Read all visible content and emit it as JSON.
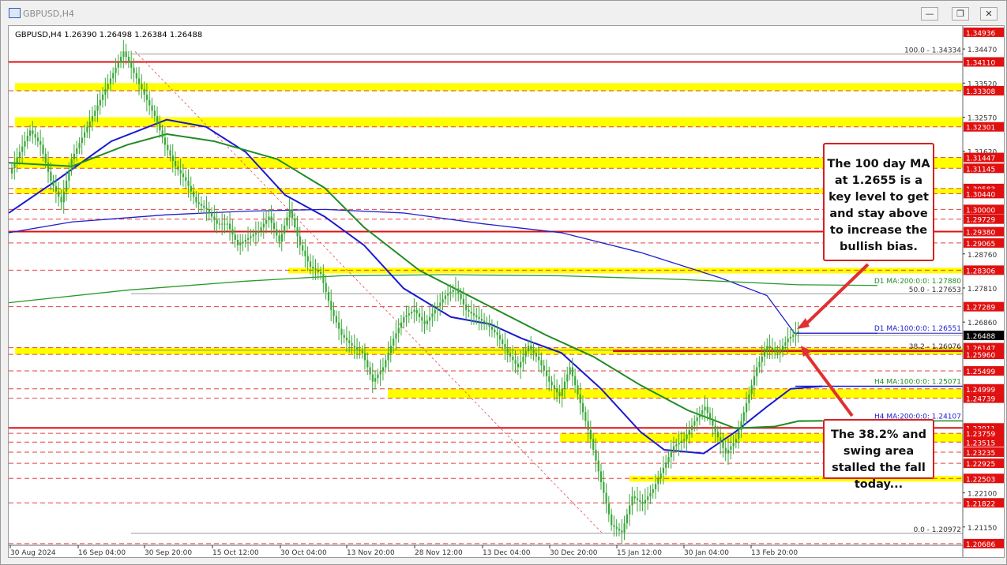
{
  "window": {
    "title": "GBPUSD,H4",
    "minimize_label": "—",
    "restore_label": "❐",
    "close_label": "✕"
  },
  "header": {
    "symbol_info": "GBPUSD,H4  1.26390 1.26498 1.26384 1.26488"
  },
  "colors": {
    "resistance_line": "#e01010",
    "zone_fill": "#ffff00",
    "ma100_d1": "#2020cc",
    "ma200_d1": "#2a9a2a",
    "ma100_h4": "#1a1ad0",
    "ma200_h4": "#228b22",
    "candle": "#3aa83a"
  },
  "annotations": {
    "top_callout": "The 100 day MA at 1.2655 is a key level to get and stay above to increase the bullish bias.",
    "bottom_callout": "The 38.2% and swing area stalled the fall today..."
  },
  "chart_data": {
    "type": "candlestick",
    "title": "GBPUSD,H4",
    "ylim": [
      1.2064,
      1.35
    ],
    "price_labels": [
      {
        "value": 1.34936,
        "text": "1.34936",
        "kind": "red"
      },
      {
        "value": 1.3447,
        "text": "1.34470",
        "kind": "tick"
      },
      {
        "value": 1.3411,
        "text": "1.34110",
        "kind": "red"
      },
      {
        "value": 1.3352,
        "text": "1.33520",
        "kind": "tick"
      },
      {
        "value": 1.33308,
        "text": "1.33308",
        "kind": "red"
      },
      {
        "value": 1.3257,
        "text": "1.32570",
        "kind": "tick"
      },
      {
        "value": 1.32301,
        "text": "1.32301",
        "kind": "red"
      },
      {
        "value": 1.3162,
        "text": "1.31620",
        "kind": "tick"
      },
      {
        "value": 1.31447,
        "text": "1.31447",
        "kind": "red"
      },
      {
        "value": 1.31145,
        "text": "1.31145",
        "kind": "red"
      },
      {
        "value": 1.30583,
        "text": "1.30583",
        "kind": "red"
      },
      {
        "value": 1.3044,
        "text": "1.30440",
        "kind": "red"
      },
      {
        "value": 1.3,
        "text": "1.30000",
        "kind": "red"
      },
      {
        "value": 1.29729,
        "text": "1.29729",
        "kind": "red"
      },
      {
        "value": 1.2938,
        "text": "1.29380",
        "kind": "red"
      },
      {
        "value": 1.29065,
        "text": "1.29065",
        "kind": "red"
      },
      {
        "value": 1.2876,
        "text": "1.28760",
        "kind": "tick"
      },
      {
        "value": 1.28306,
        "text": "1.28306",
        "kind": "red"
      },
      {
        "value": 1.2781,
        "text": "1.27810",
        "kind": "tick"
      },
      {
        "value": 1.27289,
        "text": "1.27289",
        "kind": "red"
      },
      {
        "value": 1.2686,
        "text": "1.26860",
        "kind": "tick"
      },
      {
        "value": 1.26488,
        "text": "1.26488",
        "kind": "current"
      },
      {
        "value": 1.26147,
        "text": "1.26147",
        "kind": "red"
      },
      {
        "value": 1.2596,
        "text": "1.25960",
        "kind": "red"
      },
      {
        "value": 1.25499,
        "text": "1.25499",
        "kind": "red"
      },
      {
        "value": 1.24999,
        "text": "1.24999",
        "kind": "red"
      },
      {
        "value": 1.24739,
        "text": "1.24739",
        "kind": "red"
      },
      {
        "value": 1.23911,
        "text": "1.23911",
        "kind": "red"
      },
      {
        "value": 1.23759,
        "text": "1.23759",
        "kind": "red"
      },
      {
        "value": 1.23515,
        "text": "1.23515",
        "kind": "red"
      },
      {
        "value": 1.23235,
        "text": "1.23235",
        "kind": "red"
      },
      {
        "value": 1.22925,
        "text": "1.22925",
        "kind": "red"
      },
      {
        "value": 1.22503,
        "text": "1.22503",
        "kind": "red"
      },
      {
        "value": 1.221,
        "text": "1.22100",
        "kind": "tick"
      },
      {
        "value": 1.21822,
        "text": "1.21822",
        "kind": "red"
      },
      {
        "value": 1.2115,
        "text": "1.21150",
        "kind": "tick"
      },
      {
        "value": 1.20686,
        "text": "1.20686",
        "kind": "red"
      }
    ],
    "x_labels": [
      "30 Aug 2024",
      "16 Sep 04:00",
      "30 Sep 20:00",
      "15 Oct 12:00",
      "30 Oct 04:00",
      "13 Nov 20:00",
      "28 Nov 12:00",
      "13 Dec 04:00",
      "30 Dec 20:00",
      "15 Jan 12:00",
      "30 Jan 04:00",
      "13 Feb 20:00"
    ],
    "fib_levels": [
      {
        "label": "100.0 - 1.34334",
        "value": 1.34334
      },
      {
        "label": "50.0 - 1.27653",
        "value": 1.27653
      },
      {
        "label": "38.2 - 1.26076",
        "value": 1.26076
      },
      {
        "label": "0.0 - 1.20972",
        "value": 1.20972
      }
    ],
    "ma_labels": [
      {
        "label": "D1 MA:200:0:0: 1.27880",
        "value": 1.2788
      },
      {
        "label": "D1 MA:100:0:0: 1.26551",
        "value": 1.26551
      },
      {
        "label": "H4 MA:100:0:0: 1.25071",
        "value": 1.25071
      },
      {
        "label": "H4 MA:200:0:0: 1.24107",
        "value": 1.24107
      }
    ],
    "price_series": [
      1.31,
      1.316,
      1.322,
      1.318,
      1.308,
      1.302,
      1.314,
      1.32,
      1.326,
      1.332,
      1.338,
      1.344,
      1.338,
      1.332,
      1.326,
      1.318,
      1.312,
      1.308,
      1.302,
      1.3,
      1.296,
      1.296,
      1.29,
      1.292,
      1.294,
      1.298,
      1.291,
      1.3,
      1.29,
      1.284,
      1.282,
      1.272,
      1.265,
      1.262,
      1.26,
      1.252,
      1.256,
      1.264,
      1.27,
      1.272,
      1.268,
      1.272,
      1.276,
      1.278,
      1.272,
      1.27,
      1.268,
      1.265,
      1.26,
      1.256,
      1.262,
      1.258,
      1.252,
      1.248,
      1.256,
      1.246,
      1.236,
      1.224,
      1.212,
      1.21,
      1.22,
      1.218,
      1.222,
      1.228,
      1.234,
      1.236,
      1.241,
      1.245,
      1.238,
      1.232,
      1.236,
      1.246,
      1.256,
      1.262,
      1.26,
      1.264,
      1.266
    ]
  }
}
